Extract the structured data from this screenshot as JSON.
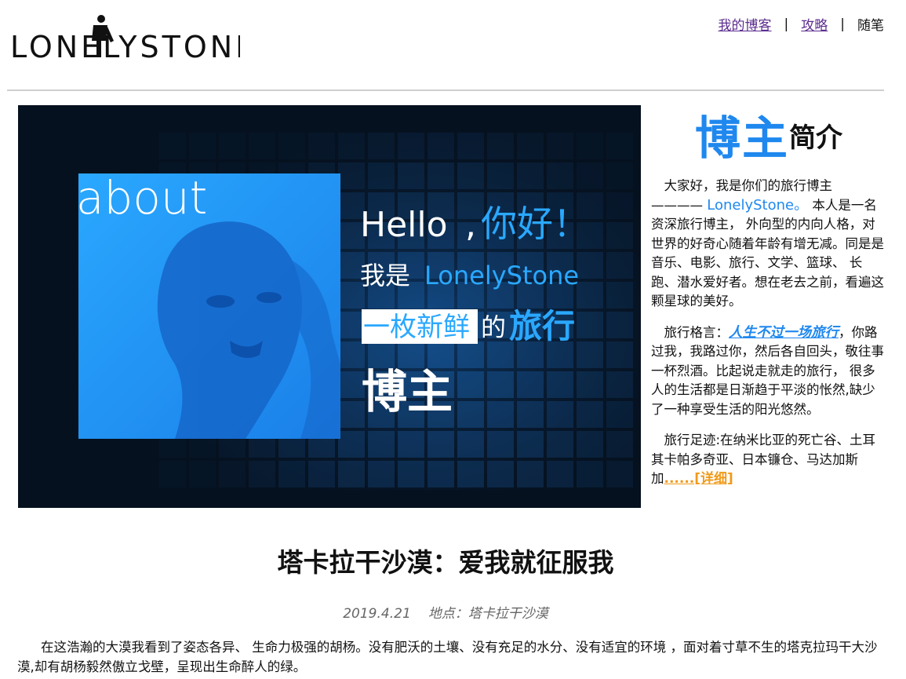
{
  "logo": {
    "text": "LONELYSTONE"
  },
  "nav": {
    "items": [
      "我的博客",
      "攻略",
      "随笔"
    ],
    "separator": "|"
  },
  "banner": {
    "about": "about",
    "hello": "Hello",
    "comma": ",",
    "nihao": "你好！",
    "woshi": "我是",
    "name": "LonelyStone",
    "yimei": "一枚新鲜",
    "de": "的",
    "lvxing": "旅行",
    "bozhu": "博主"
  },
  "sidebar": {
    "title_big": "博主",
    "title_small": "简介",
    "intro_pre": "大家好，我是你们的旅行博主 ———— ",
    "intro_name": "LonelyStone。",
    "intro_post": " 本人是一名资深旅行博主， 外向型的内向人格，对世界的好奇心随着年龄有增无减。同是是音乐、电影、旅行、文学、篮球、 长跑、潜水爱好者。想在老去之前，看遍这颗星球的美好。",
    "motto_label": "旅行格言：",
    "motto": "人生不过一场旅行",
    "motto_post": "，你路过我，我路过你，然后各自回头，敬往事一杯烈酒。比起说走就走的旅行， 很多人的生活都是日渐趋于平淡的怅然,缺少了一种享受生活的阳光悠然。",
    "footprint": "旅行足迹:在纳米比亚的死亡谷、土耳其卡帕多奇亚、日本镰仓、马达加斯加",
    "more": "......[详细]"
  },
  "article": {
    "title": "塔卡拉干沙漠：爱我就征服我",
    "date": "2019.4.21",
    "location": "地点：塔卡拉干沙漠",
    "body": "在这浩瀚的大漠我看到了姿态各异、 生命力极强的胡杨。没有肥沃的土壤、没有充足的水分、没有适宜的环境 ，面对着寸草不生的塔克拉玛干大沙漠,却有胡杨毅然傲立戈壁，呈现出生命醉人的绿。"
  },
  "colors": {
    "accent_blue": "#1f88ee",
    "link_purple": "#5b2d8e",
    "more_orange": "#f09a1a",
    "banner_bg": "#06111f"
  }
}
